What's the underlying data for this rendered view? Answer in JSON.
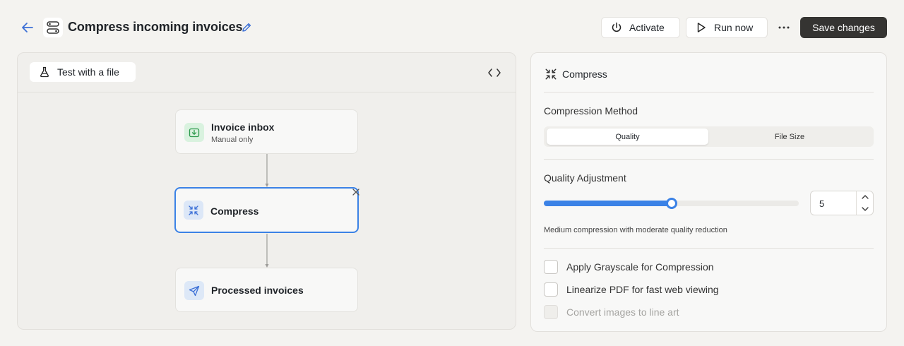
{
  "header": {
    "title": "Compress incoming invoices",
    "activate_label": "Activate",
    "run_label": "Run now",
    "save_label": "Save changes"
  },
  "canvas": {
    "test_label": "Test with a file",
    "nodes": [
      {
        "title": "Invoice inbox",
        "subtitle": "Manual only"
      },
      {
        "title": "Compress"
      },
      {
        "title": "Processed invoices"
      }
    ]
  },
  "panel": {
    "title": "Compress",
    "method_label": "Compression Method",
    "method_options": [
      "Quality",
      "File Size"
    ],
    "method_selected": "Quality",
    "quality_label": "Quality Adjustment",
    "quality_value": "5",
    "quality_fraction": 0.5,
    "quality_help": "Medium compression with moderate quality reduction",
    "options": [
      {
        "label": "Apply Grayscale for Compression",
        "checked": false,
        "disabled": false
      },
      {
        "label": "Linearize PDF for fast web viewing",
        "checked": false,
        "disabled": false
      },
      {
        "label": "Convert images to line art",
        "checked": false,
        "disabled": true
      }
    ]
  },
  "colors": {
    "accent": "#3b82e6",
    "save_bg": "#353432",
    "inbox_icon_bg": "#d9f2df",
    "inbox_icon": "#2e9a4e",
    "compress_icon_bg": "#dce7f7",
    "send_icon_bg": "#dde8f7"
  }
}
